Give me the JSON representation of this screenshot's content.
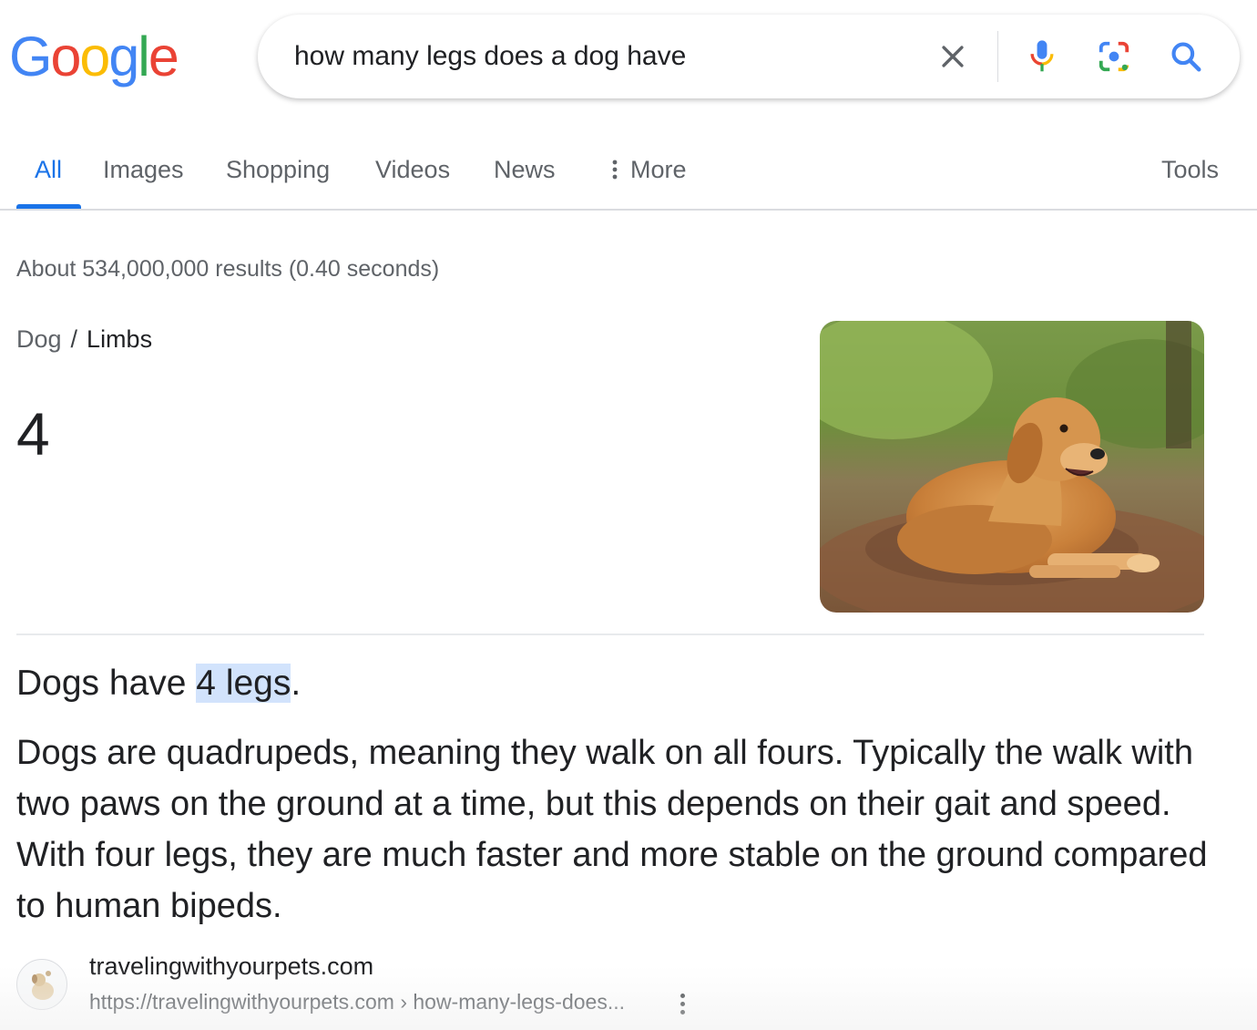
{
  "logo": {
    "letters": [
      {
        "ch": "G",
        "color": "#4285F4"
      },
      {
        "ch": "o",
        "color": "#EA4335"
      },
      {
        "ch": "o",
        "color": "#FBBC05"
      },
      {
        "ch": "g",
        "color": "#4285F4"
      },
      {
        "ch": "l",
        "color": "#34A853"
      },
      {
        "ch": "e",
        "color": "#EA4335"
      }
    ]
  },
  "search": {
    "query": "how many legs does a dog have",
    "clear_icon": "close-icon",
    "voice_icon": "microphone-icon",
    "lens_icon": "camera-lens-icon",
    "submit_icon": "search-icon"
  },
  "tabs": [
    {
      "label": "All",
      "active": true
    },
    {
      "label": "Images"
    },
    {
      "label": "Shopping"
    },
    {
      "label": "Videos"
    },
    {
      "label": "News"
    },
    {
      "label": "More",
      "icon": "vertical-dots-icon"
    }
  ],
  "tools_label": "Tools",
  "stats": "About 534,000,000 results (0.40 seconds)",
  "knowledge": {
    "breadcrumb_parent": "Dog",
    "breadcrumb_sep": "/",
    "breadcrumb_current": "Limbs",
    "answer": "4"
  },
  "snippet": {
    "title_before": "Dogs have ",
    "title_highlight": "4 legs",
    "title_after": ".",
    "body": "Dogs are quadrupeds, meaning they walk on all fours. Typically the walk with two paws on the ground at a time, but this depends on their gait and speed. With four legs, they are much faster and more stable on the ground compared to human bipeds."
  },
  "source": {
    "site_name": "travelingwithyourpets.com",
    "url": "https://travelingwithyourpets.com › how-many-legs-does..."
  },
  "colors": {
    "accent": "#1a73e8",
    "highlight": "#d2e3fc",
    "text": "#202124",
    "muted": "#5f6368"
  }
}
